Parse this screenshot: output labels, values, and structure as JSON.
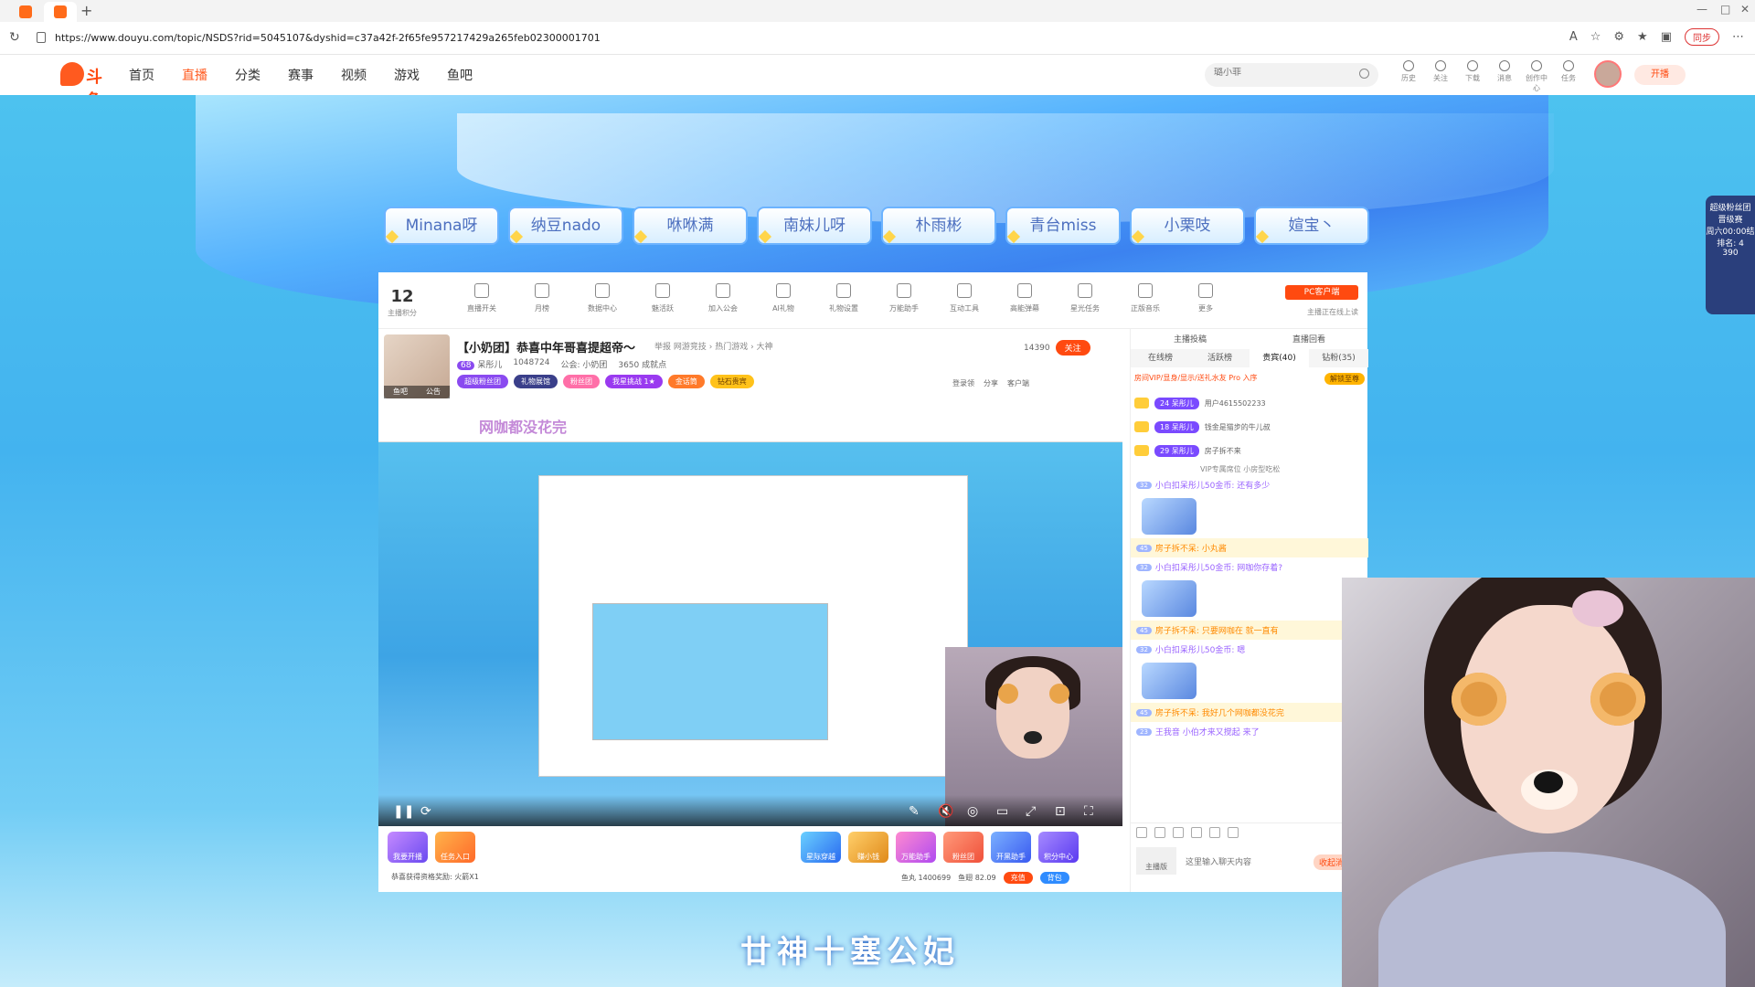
{
  "browser": {
    "url": "https://www.douyu.com/topic/NSDS?rid=5045107&dyshid=c37a42f-2f65fe957217429a265feb02300001701",
    "sync_label": "同步"
  },
  "site": {
    "logo_text": "斗鱼",
    "nav": [
      "首页",
      "直播",
      "分类",
      "赛事",
      "视频",
      "游戏",
      "鱼吧"
    ],
    "nav_active": "直播",
    "search_placeholder": "璐小菲",
    "header_icons": [
      {
        "icon": "history-icon",
        "label": "历史"
      },
      {
        "icon": "heart-icon",
        "label": "关注"
      },
      {
        "icon": "download-icon",
        "label": "下载"
      },
      {
        "icon": "bell-icon",
        "label": "消息"
      },
      {
        "icon": "creator-icon",
        "label": "创作中心"
      },
      {
        "icon": "gift-icon",
        "label": "任务"
      }
    ],
    "start_stream_label": "开播"
  },
  "anchors": [
    "Minana呀",
    "纳豆nado",
    "咻咻满",
    "南妹儿呀",
    "朴雨彬",
    "青台miss",
    "小栗吱",
    "媗宝丶"
  ],
  "toolbar": {
    "level_num": "12",
    "level_label": "主播积分",
    "tools": [
      "直播开关",
      "月榜",
      "数据中心",
      "魅活跃",
      "加入公会",
      "AI礼物",
      "礼物设置",
      "万能助手",
      "互动工具",
      "高能弹幕",
      "星光任务",
      "正版音乐",
      "更多"
    ],
    "pc_client_label": "PC客户端",
    "pc_sub_label": "主播正在线上读"
  },
  "room": {
    "title": "【小奶团】恭喜中年哥喜提超帝～",
    "report": "举报",
    "category": "网游竞技 › 热门游戏 › 大神",
    "level_badge": "68",
    "streamer": "呆彤儿",
    "heat": "1048724",
    "guild": "公会: 小奶团",
    "fans": "3650 成就点",
    "followers": "14390",
    "follow_label": "关注",
    "badges": [
      "超级粉丝团",
      "礼物展馆",
      "粉丝团",
      "我星挑战 1★",
      "金话筒",
      "钻石贵宾"
    ],
    "actions": [
      "登录领",
      "分享",
      "客户端"
    ]
  },
  "video": {
    "danmu_text": "网咖都没花完"
  },
  "giftbar": {
    "left_items": [
      "我要开播",
      "任务入口"
    ],
    "right_items": [
      "星际穿越",
      "赚小钱",
      "万能助手",
      "粉丝团",
      "开黑助手",
      "积分中心"
    ],
    "notice": "恭喜获得资格奖励: 火箭X1",
    "fishball": "鱼丸 1400699",
    "fishcoin": "鱼翅 82.09",
    "recharge_label": "充值",
    "bag_label": "背包"
  },
  "side": {
    "top_links": [
      "主播投稿",
      "直播回看"
    ],
    "tabs": [
      "在线榜",
      "活跃榜",
      "贵宾(40)",
      "钻粉(35)"
    ],
    "vip_text": "房间VIP/显身/显示/送礼水友 Pro 入序",
    "unlock_label": "解锁至尊",
    "ranks": [
      {
        "badge": "24 呆彤儿",
        "name": "用户4615502233"
      },
      {
        "badge": "18 呆彤儿",
        "name": "钱金是猫步的牛儿叔"
      },
      {
        "badge": "29 呆彤儿",
        "name": "房子拆不来"
      }
    ],
    "vip_note": "VIP专属席位 小房型吃松",
    "chat": [
      {
        "lv": "32",
        "text": "小白扣呆彤儿50金币: 还有多少",
        "hi": false
      },
      {
        "lv": "45",
        "text": "房子拆不呆: 小丸酱",
        "hi": true
      },
      {
        "lv": "32",
        "text": "小白扣呆彤儿50金币: 网咖你存着?",
        "hi": false
      },
      {
        "lv": "45",
        "text": "房子拆不呆: 只要网咖在 就一直有",
        "hi": true
      },
      {
        "lv": "32",
        "text": "小白扣呆彤儿50金币: 嗯",
        "hi": false
      },
      {
        "lv": "45",
        "text": "房子拆不呆: 我好几个网咖都没花完",
        "hi": true
      },
      {
        "lv": "23",
        "text": "王我音 小伯才来又搅起 来了",
        "hi": false
      }
    ],
    "chat_placeholder": "这里输入聊天内容",
    "send_label": "收起消息",
    "user_btn": "主播版"
  },
  "bottom_title": "廿神十塞公妃",
  "right_widget": {
    "title": "超级粉丝团",
    "sub": "晋级赛",
    "time": "周六00:00结",
    "rank": "排名: 4",
    "val": "390"
  }
}
